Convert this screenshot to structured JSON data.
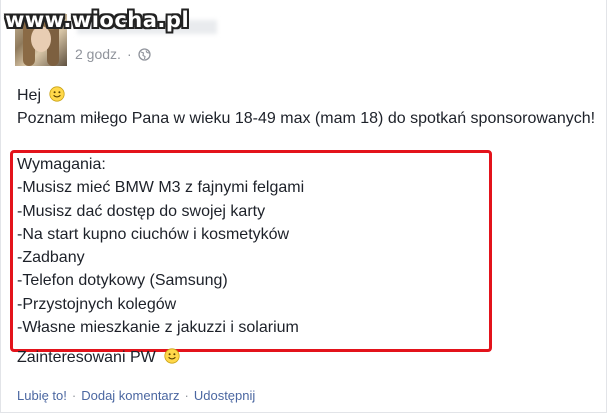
{
  "watermark": "www.wiocha.pl",
  "post": {
    "timestamp": "2 godz.",
    "line_greeting": "Hej",
    "line_intro": "Poznam miłego Pana w wieku 18-49 max (mam 18) do spotkań sponsorowanych!",
    "requirements_header": "Wymagania:",
    "requirements": [
      "-Musisz mieć BMW M3 z fajnymi felgami",
      "-Musisz dać dostęp do swojej karty",
      "-Na start kupno ciuchów i kosmetyków",
      "-Zadbany",
      "-Telefon dotykowy (Samsung)",
      "-Przystojnych kolegów",
      "-Własne mieszkanie z jakuzzi i solarium"
    ],
    "followup": "Zainteresowani PW"
  },
  "actions": {
    "like": "Lubię to!",
    "comment": "Dodaj komentarz",
    "share": "Udostępnij",
    "separator": "·"
  },
  "colors": {
    "highlight_border": "#e3131b",
    "link": "#4b67a1",
    "meta_text": "#90949c",
    "body_text": "#1d2129"
  },
  "icons": {
    "privacy": "globe-icon",
    "emoji": "smiley-icon"
  }
}
